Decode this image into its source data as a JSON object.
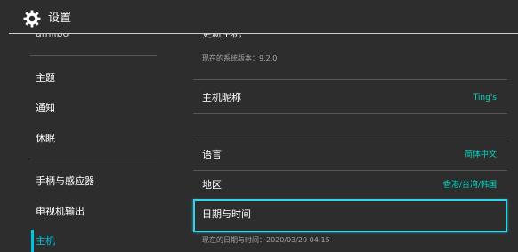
{
  "header": {
    "title": "设置",
    "icon": "gear-icon"
  },
  "sidebar": {
    "partial_item": "amiibo",
    "items": [
      {
        "label": "主题"
      },
      {
        "label": "通知"
      },
      {
        "label": "休眠"
      },
      {
        "label": "手柄与感应器"
      },
      {
        "label": "电视机输出"
      },
      {
        "label": "主机",
        "selected": true
      }
    ]
  },
  "main": {
    "update_label": "更新主机",
    "system_version": "现在的系统版本：9.2.0",
    "nickname_label": "主机昵称",
    "nickname_value": "Ting's",
    "language_label": "语言",
    "language_value": "简体中文",
    "region_label": "地区",
    "region_value": "香港/台湾/韩国",
    "datetime_label": "日期与时间",
    "datetime_current": "现在的日期与时间：2020/03/20 04:15"
  },
  "colors": {
    "background": "#2d2d2d",
    "accent": "#00c3e3",
    "value_text": "#00d8c4",
    "focus_border": "#35d1e6"
  }
}
